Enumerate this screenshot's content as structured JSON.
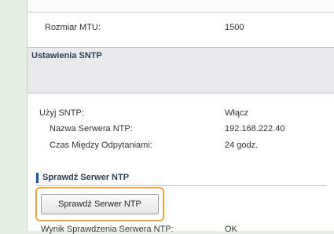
{
  "mtu": {
    "label": "Rozmiar MTU:",
    "value": "1500"
  },
  "sntp_section": {
    "title": "Ustawienia SNTP"
  },
  "use_sntp": {
    "label": "Użyj SNTP:",
    "value": "Włącz"
  },
  "ntp_server": {
    "label": "Nazwa Serwera NTP:",
    "value": "192.168.222.40"
  },
  "poll_interval": {
    "label": "Czas Między Odpytaniami:",
    "value": "24 godz."
  },
  "check_section": {
    "title": "Sprawdź Serwer NTP"
  },
  "check_button": {
    "label": "Sprawdź Serwer NTP"
  },
  "check_result": {
    "label": "Wynik Sprawdzenia Serwera NTP:",
    "value": "OK"
  },
  "colors": {
    "highlight": "#f0a640",
    "section_accent": "#1e4f9a"
  }
}
